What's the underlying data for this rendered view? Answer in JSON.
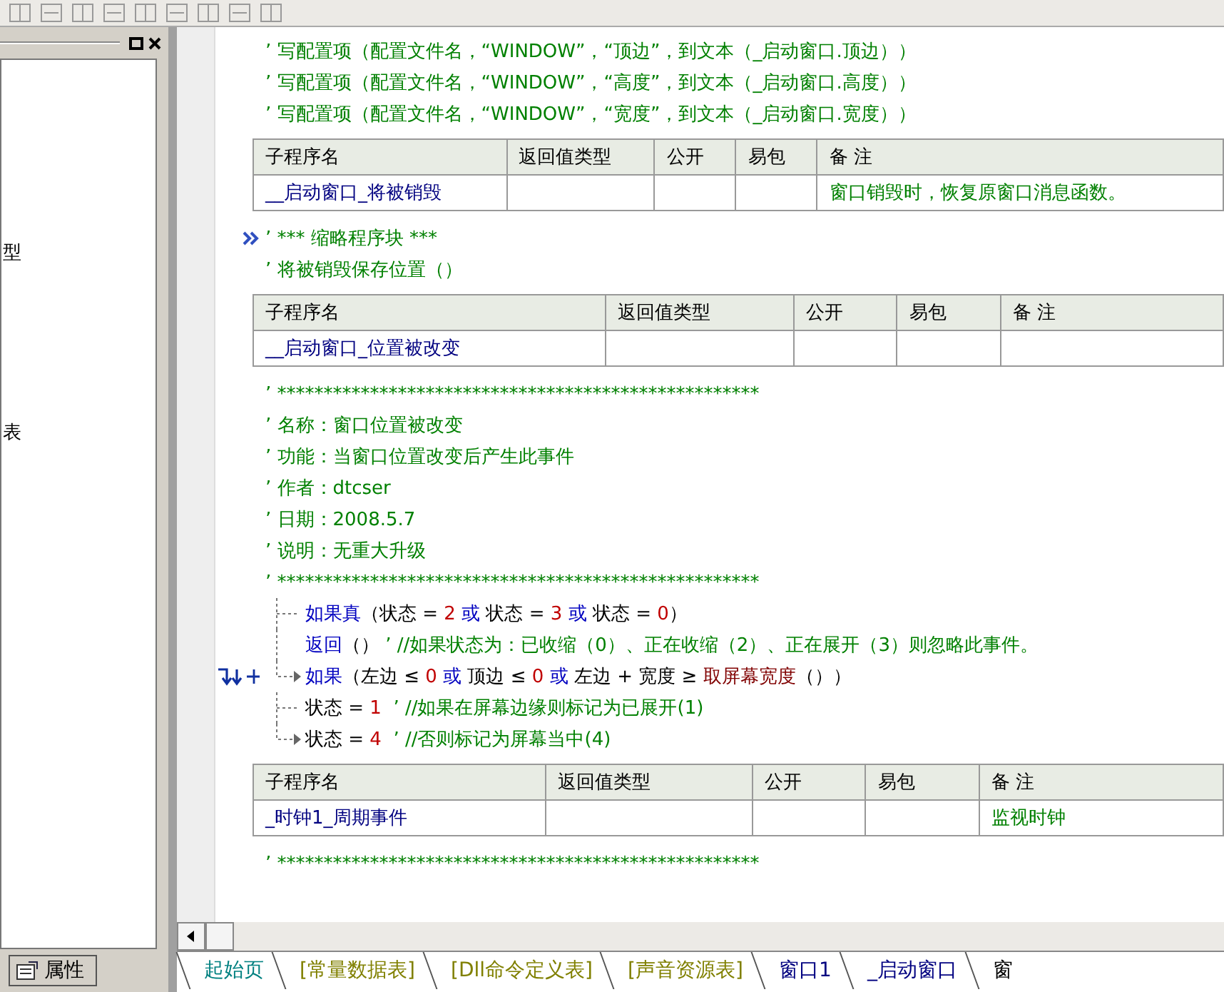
{
  "left_panel": {
    "tree_items": [
      "型",
      "表"
    ],
    "tab": "属性"
  },
  "editor": {
    "blocks": [
      {
        "kind": "line",
        "tokens": [
          {
            "kind": "comment",
            "text": "’ 写配置项（配置文件名，“WINDOW”，“顶边”，到文本（_启动窗口.顶边））"
          }
        ]
      },
      {
        "kind": "line",
        "tokens": [
          {
            "kind": "comment",
            "text": "’ 写配置项（配置文件名，“WINDOW”，“高度”，到文本（_启动窗口.高度））"
          }
        ]
      },
      {
        "kind": "line",
        "tokens": [
          {
            "kind": "comment",
            "text": "’ 写配置项（配置文件名，“WINDOW”，“宽度”，到文本（_启动窗口.宽度））"
          }
        ]
      },
      {
        "kind": "table",
        "header": [
          "子程序名",
          "返回值类型",
          "公开",
          "易包",
          "备 注"
        ],
        "row": {
          "name": "__启动窗口_将被销毁",
          "remark": "窗口销毁时，恢复原窗口消息函数。"
        }
      },
      {
        "kind": "collapsed",
        "tokens": [
          {
            "kind": "comment",
            "text": "’ *** 缩略程序块 ***"
          }
        ]
      },
      {
        "kind": "line",
        "tokens": [
          {
            "kind": "comment",
            "text": "’ 将被销毁保存位置（）"
          }
        ]
      },
      {
        "kind": "table",
        "header": [
          "子程序名",
          "返回值类型",
          "公开",
          "易包",
          "备 注"
        ],
        "row": {
          "name": "__启动窗口_位置被改变"
        }
      },
      {
        "kind": "line",
        "tokens": [
          {
            "kind": "comment",
            "text": "’ ****************************************************"
          }
        ]
      },
      {
        "kind": "line",
        "tokens": [
          {
            "kind": "comment",
            "text": "’ 名称：窗口位置被改变"
          }
        ]
      },
      {
        "kind": "line",
        "tokens": [
          {
            "kind": "comment",
            "text": "’ 功能：当窗口位置改变后产生此事件"
          }
        ]
      },
      {
        "kind": "line",
        "tokens": [
          {
            "kind": "comment",
            "text": "’ 作者：dtcser"
          }
        ]
      },
      {
        "kind": "line",
        "tokens": [
          {
            "kind": "comment",
            "text": "’ 日期：2008.5.7"
          }
        ]
      },
      {
        "kind": "line",
        "tokens": [
          {
            "kind": "comment",
            "text": "’ 说明：无重大升级"
          }
        ]
      },
      {
        "kind": "line",
        "tokens": [
          {
            "kind": "comment",
            "text": "’ ****************************************************"
          }
        ]
      },
      {
        "kind": "branch",
        "lines": [
          {
            "kind": "dash",
            "tokens": [
              {
                "kind": "keyword",
                "text": "如果真"
              },
              {
                "kind": "plain",
                "text": "（状态 = "
              },
              {
                "kind": "number",
                "text": "2"
              },
              {
                "kind": "keyword",
                "text": " 或 "
              },
              {
                "kind": "plain",
                "text": "状态 = "
              },
              {
                "kind": "number",
                "text": "3"
              },
              {
                "kind": "keyword",
                "text": " 或 "
              },
              {
                "kind": "plain",
                "text": "状态 = "
              },
              {
                "kind": "number",
                "text": "0"
              },
              {
                "kind": "plain",
                "text": "）"
              }
            ]
          },
          {
            "kind": "line",
            "tokens": [
              {
                "kind": "keyword",
                "text": "返回"
              },
              {
                "kind": "plain",
                "text": "（） "
              },
              {
                "kind": "comment",
                "text": "’ //如果状态为：已收缩（0）、正在收缩（2）、正在展开（3）则忽略此事件。"
              }
            ]
          },
          {
            "kind": "condition",
            "tokens": [
              {
                "kind": "keyword",
                "text": "如果"
              },
              {
                "kind": "plain",
                "text": "（左边 ≤ "
              },
              {
                "kind": "number",
                "text": "0"
              },
              {
                "kind": "keyword",
                "text": " 或 "
              },
              {
                "kind": "plain",
                "text": "顶边 ≤ "
              },
              {
                "kind": "number",
                "text": "0"
              },
              {
                "kind": "keyword",
                "text": " 或 "
              },
              {
                "kind": "plain",
                "text": "左边 + 宽度 ≥ "
              },
              {
                "kind": "func",
                "text": "取屏幕宽度"
              },
              {
                "kind": "plain",
                "text": "（））"
              }
            ]
          },
          {
            "kind": "dash",
            "tokens": [
              {
                "kind": "plain",
                "text": "状态 = "
              },
              {
                "kind": "number",
                "text": "1"
              },
              {
                "kind": "comment",
                "text": "  ’ //如果在屏幕边缘则标记为已展开(1)"
              }
            ]
          },
          {
            "kind": "arrow",
            "tokens": [
              {
                "kind": "plain",
                "text": "状态 = "
              },
              {
                "kind": "number",
                "text": "4"
              },
              {
                "kind": "comment",
                "text": "  ’ //否则标记为屏幕当中(4)"
              }
            ]
          }
        ]
      },
      {
        "kind": "table",
        "header": [
          "子程序名",
          "返回值类型",
          "公开",
          "易包",
          "备 注"
        ],
        "row": {
          "name": "_时钟1_周期事件",
          "remark": "监视时钟"
        }
      },
      {
        "kind": "line",
        "tokens": [
          {
            "kind": "comment",
            "text": "’ ****************************************************"
          }
        ]
      }
    ]
  },
  "tabs": [
    {
      "label": "起始页",
      "color": "#008080"
    },
    {
      "label": "[常量数据表]",
      "color": "#808000"
    },
    {
      "label": "[Dll命令定义表]",
      "color": "#808000"
    },
    {
      "label": "[声音资源表]",
      "color": "#808000"
    },
    {
      "label": "窗口1",
      "color": "#000080"
    },
    {
      "label": "_启动窗口",
      "color": "#000080"
    },
    {
      "label": "窗",
      "color": "#000000"
    }
  ]
}
